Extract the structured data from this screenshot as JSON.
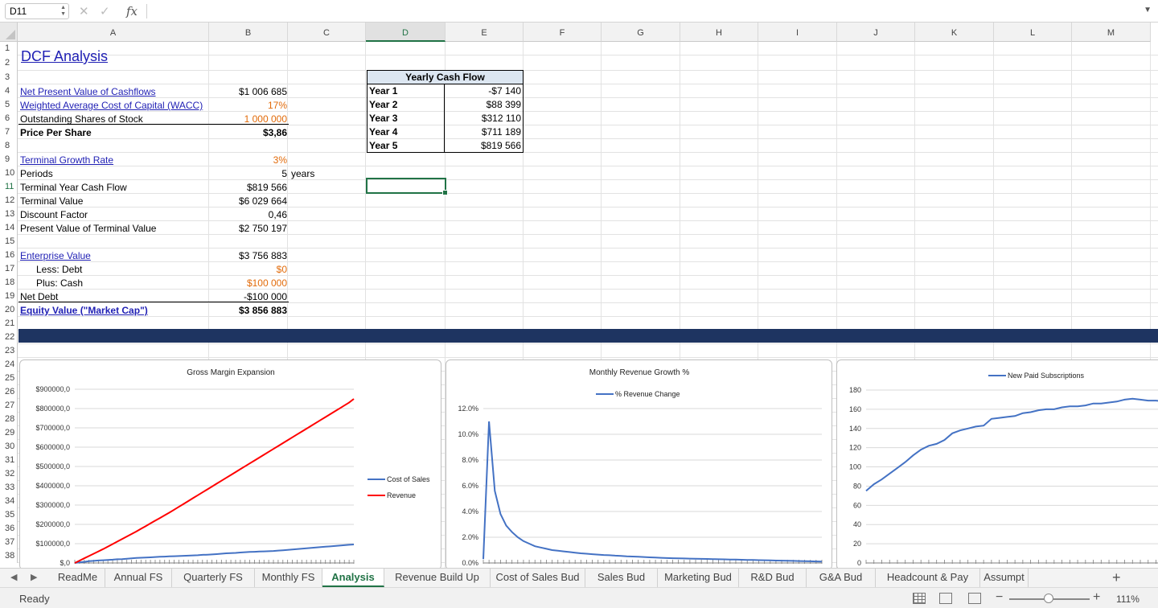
{
  "formula_bar": {
    "name_box": "D11",
    "fx": "fx",
    "formula": ""
  },
  "columns": [
    "A",
    "B",
    "C",
    "D",
    "E",
    "F",
    "G",
    "H",
    "I",
    "J",
    "K",
    "L",
    "M"
  ],
  "rows": [
    "1",
    "2",
    "3",
    "4",
    "5",
    "6",
    "7",
    "8",
    "9",
    "10",
    "11",
    "12",
    "13",
    "14",
    "15",
    "16",
    "17",
    "18",
    "19",
    "20",
    "21",
    "22",
    "23",
    "24",
    "25",
    "26",
    "27",
    "28",
    "29",
    "30",
    "31",
    "32",
    "33",
    "34",
    "35",
    "36",
    "37",
    "38"
  ],
  "selected_cell": "D11",
  "sheet": {
    "title": "DCF Analysis",
    "npv_label": "Net Present Value of Cashflows",
    "npv_value": "$1 006 685",
    "wacc_label": "Weighted Average Cost of Capital (WACC)",
    "wacc_value": "17%",
    "shares_label": "Outstanding Shares of Stock",
    "shares_value": "1 000 000",
    "pps_label": "Price Per Share",
    "pps_value": "$3,86",
    "tgr_label": "Terminal Growth Rate",
    "tgr_value": "3%",
    "periods_label": "Periods",
    "periods_value": "5",
    "periods_unit": "years",
    "tycf_label": "Terminal Year Cash Flow",
    "tycf_value": "$819 566",
    "tv_label": "Terminal Value",
    "tv_value": "$6 029 664",
    "df_label": "Discount Factor",
    "df_value": "0,46",
    "pvtv_label": "Present Value of Terminal Value",
    "pvtv_value": "$2 750 197",
    "ev_label": "Enterprise Value",
    "ev_value": "$3 756 883",
    "debt_label": "Less: Debt",
    "debt_value": "$0",
    "cash_label": "Plus: Cash",
    "cash_value": "$100 000",
    "netdebt_label": "Net Debt",
    "netdebt_value": "-$100 000",
    "equity_label": "Equity Value (\"Market Cap\")",
    "equity_value": "$3 856 883"
  },
  "yearly_cash_flow": {
    "header": "Yearly Cash Flow",
    "rows": [
      {
        "year": "Year 1",
        "value": "-$7 140"
      },
      {
        "year": "Year 2",
        "value": "$88 399"
      },
      {
        "year": "Year 3",
        "value": "$312 110"
      },
      {
        "year": "Year 4",
        "value": "$711 189"
      },
      {
        "year": "Year 5",
        "value": "$819 566"
      }
    ]
  },
  "chart_data": [
    {
      "type": "line",
      "title": "Gross Margin Expansion",
      "ylim": [
        0,
        900000
      ],
      "y_ticks": [
        "$,0",
        "$100000,0",
        "$200000,0",
        "$300000,0",
        "$400000,0",
        "$500000,0",
        "$600000,0",
        "$700000,0",
        "$800000,0",
        "$900000,0"
      ],
      "legend_position": "right",
      "series": [
        {
          "name": "Cost of Sales",
          "color": "#4472c4",
          "values": [
            0,
            3000,
            6000,
            9000,
            11000,
            13000,
            14000,
            16000,
            17000,
            19000,
            20000,
            22000,
            24000,
            26000,
            27000,
            28000,
            29000,
            31000,
            32000,
            33000,
            34000,
            35000,
            36000,
            37000,
            38000,
            39000,
            40000,
            42000,
            43000,
            44000,
            46000,
            48000,
            50000,
            51000,
            52000,
            54000,
            56000,
            57000,
            58000,
            59000,
            60000,
            61000,
            62000,
            64000,
            66000,
            68000,
            70000,
            72000,
            74000,
            76000,
            78000,
            80000,
            82000,
            84000,
            86000,
            88000,
            90000,
            92000,
            94000,
            96000
          ]
        },
        {
          "name": "Revenue",
          "color": "#ff0000",
          "values": [
            0,
            12000,
            24000,
            36000,
            48000,
            60000,
            72000,
            85000,
            98000,
            111000,
            124000,
            137000,
            150000,
            163000,
            177000,
            191000,
            205000,
            219000,
            233000,
            247000,
            261000,
            276000,
            291000,
            306000,
            321000,
            336000,
            351000,
            366000,
            381000,
            396000,
            411000,
            426000,
            441000,
            456000,
            471000,
            486000,
            501000,
            516000,
            531000,
            546000,
            561000,
            576000,
            591000,
            606000,
            621000,
            636000,
            651000,
            666000,
            681000,
            696000,
            711000,
            726000,
            741000,
            756000,
            771000,
            786000,
            801000,
            816000,
            831000,
            850000
          ]
        }
      ]
    },
    {
      "type": "line",
      "title": "Monthly Revenue Growth %",
      "ylim": [
        0,
        12
      ],
      "y_ticks": [
        "0.0%",
        "2.0%",
        "4.0%",
        "6.0%",
        "8.0%",
        "10.0%",
        "12.0%"
      ],
      "legend_position": "top",
      "series": [
        {
          "name": "% Revenue Change",
          "color": "#4472c4",
          "values": [
            0.3,
            11.0,
            5.6,
            3.8,
            2.9,
            2.4,
            2.0,
            1.7,
            1.5,
            1.3,
            1.2,
            1.1,
            1.0,
            0.95,
            0.9,
            0.85,
            0.8,
            0.75,
            0.72,
            0.68,
            0.65,
            0.62,
            0.6,
            0.57,
            0.55,
            0.52,
            0.5,
            0.48,
            0.46,
            0.44,
            0.42,
            0.4,
            0.38,
            0.37,
            0.36,
            0.35,
            0.34,
            0.33,
            0.32,
            0.31,
            0.3,
            0.29,
            0.28,
            0.27,
            0.26,
            0.25,
            0.24,
            0.23,
            0.22,
            0.21,
            0.2,
            0.19,
            0.18,
            0.17,
            0.16,
            0.15,
            0.14,
            0.13,
            0.12,
            0.11
          ]
        }
      ]
    },
    {
      "type": "line",
      "title": "",
      "ylim": [
        0,
        180
      ],
      "y_ticks": [
        "0",
        "20",
        "40",
        "60",
        "80",
        "100",
        "120",
        "140",
        "160",
        "180"
      ],
      "legend_position": "top",
      "series": [
        {
          "name": "New Paid Subscriptions",
          "color": "#4472c4",
          "values": [
            75,
            82,
            87,
            93,
            99,
            105,
            112,
            118,
            122,
            124,
            128,
            135,
            138,
            140,
            142,
            143,
            150,
            151,
            152,
            153,
            156,
            157,
            159,
            160,
            160,
            162,
            163,
            163,
            164,
            166,
            166,
            167,
            168,
            170,
            171,
            170,
            169,
            169,
            168,
            170
          ]
        }
      ]
    }
  ],
  "tabs": [
    "ReadMe",
    "Annual FS",
    "Quarterly FS",
    "Monthly FS",
    "Analysis",
    "Revenue Build Up",
    "Cost of Sales Bud",
    "Sales Bud",
    "Marketing Bud",
    "R&D Bud",
    "G&A Bud",
    "Headcount & Pay",
    "Assumpt"
  ],
  "active_tab": "Analysis",
  "status": {
    "text": "Ready",
    "zoom": "111%"
  },
  "icons": {
    "add_sheet": "+",
    "prev_sheet": "◀",
    "next_sheet": "▶"
  }
}
